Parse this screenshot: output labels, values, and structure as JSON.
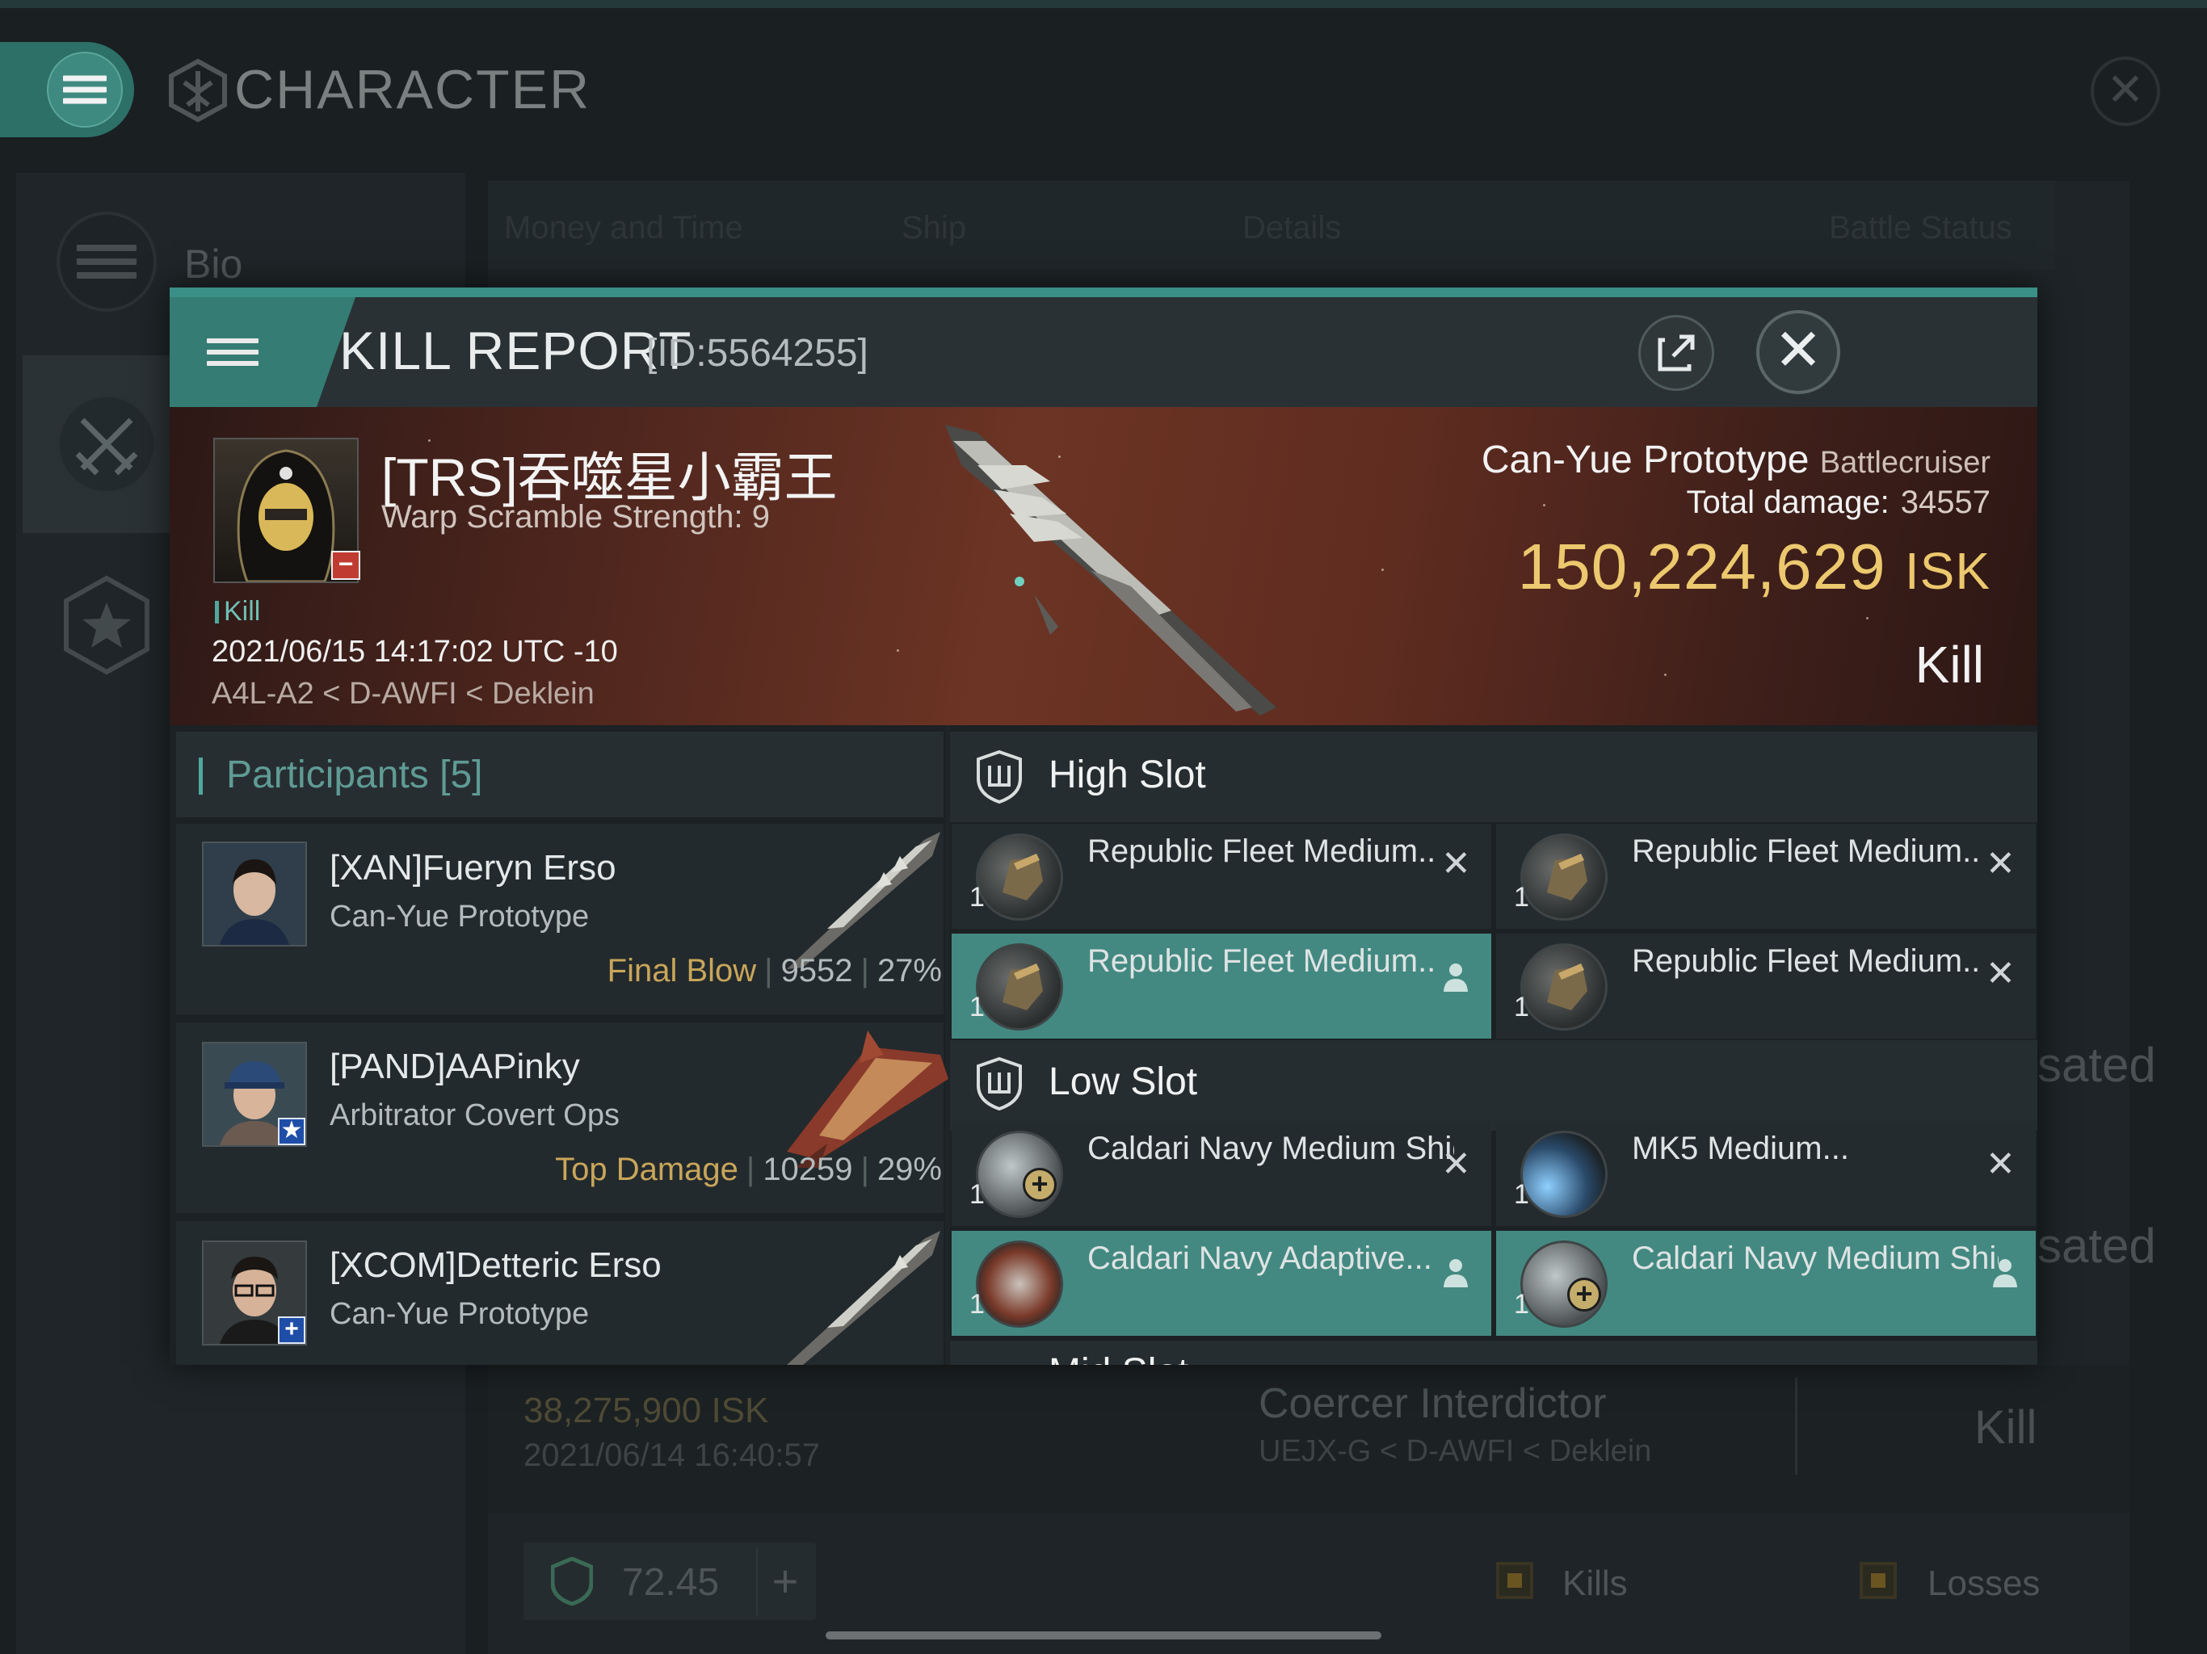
{
  "window": {
    "title": "CHARACTER",
    "close_symbol": "✕"
  },
  "sidebar": {
    "bio_label": "Bio",
    "icons": [
      "list-icon",
      "crossed-swords-icon",
      "star-icon"
    ]
  },
  "background": {
    "tabs": [
      "Money and Time",
      "Ship",
      "Details",
      "Battle Status"
    ],
    "row": {
      "amount": "38,275,900",
      "amount_unit": "ISK",
      "datetime": "2021/06/14  16:40:57",
      "ship": "Coercer Interdictor",
      "system": "UEJX-G < D-AWFI < Deklein",
      "status": "Kill"
    },
    "side_texts": [
      "sated",
      "sated"
    ],
    "bottom": {
      "value": "72.45",
      "plus": "+",
      "kills_label": "Kills",
      "losses_label": "Losses"
    }
  },
  "kill_report": {
    "title": "KILL REPORT",
    "id": "[ID:5564255]",
    "close_symbol": "✕",
    "victim": {
      "name": "[TRS]吞噬星小霸王",
      "warp_scramble": "Warp Scramble Strength: 9",
      "tag": "Kill",
      "datetime": "2021/06/15 14:17:02 UTC -10",
      "location": "A4L-A2 < D-AWFI < Deklein",
      "badge": "−"
    },
    "summary": {
      "ship_name": "Can-Yue Prototype",
      "ship_class": "Battlecruiser",
      "total_damage_label": "Total damage:",
      "total_damage": "34557",
      "isk_value": "150,224,629",
      "isk_unit": "ISK",
      "result": "Kill"
    },
    "participants": {
      "title": "Participants",
      "count": "[5]",
      "items": [
        {
          "name": "[XAN]Fueryn Erso",
          "ship": "Can-Yue Prototype",
          "label": "Final Blow",
          "damage": "9552",
          "percent": "27%"
        },
        {
          "name": "[PAND]AAPinky",
          "ship": "Arbitrator Covert Ops",
          "label": "Top Damage",
          "damage": "10259",
          "percent": "29%",
          "badge": "★"
        },
        {
          "name": "[XCOM]Detteric Erso",
          "ship": "Can-Yue Prototype",
          "label": "",
          "damage": "",
          "percent": "",
          "badge": "+"
        }
      ]
    },
    "slots": {
      "high": {
        "title": "High Slot",
        "modules": [
          {
            "name": "Republic Fleet Medium...",
            "qty": "1",
            "state": "destroyed",
            "icon": "artillery-icon"
          },
          {
            "name": "Republic Fleet Medium...",
            "qty": "1",
            "state": "destroyed",
            "icon": "artillery-icon"
          },
          {
            "name": "Republic Fleet Medium...",
            "qty": "1",
            "state": "dropped",
            "icon": "artillery-icon"
          },
          {
            "name": "Republic Fleet Medium...",
            "qty": "1",
            "state": "destroyed",
            "icon": "artillery-icon"
          }
        ]
      },
      "low": {
        "title": "Low Slot",
        "modules": [
          {
            "name": "Caldari Navy Medium Shield ...",
            "qty": "1",
            "state": "destroyed",
            "icon": "shield-extender-icon"
          },
          {
            "name": "MK5 Medium...",
            "qty": "1",
            "state": "destroyed",
            "icon": "thruster-icon"
          },
          {
            "name": "Caldari Navy Adaptive...",
            "qty": "1",
            "state": "dropped",
            "icon": "adaptive-shield-icon"
          },
          {
            "name": "Caldari Navy Medium Shield ...",
            "qty": "1",
            "state": "dropped",
            "icon": "shield-extender-icon"
          }
        ]
      },
      "mid_partial": {
        "title": "Mid Slot"
      }
    },
    "symbols": {
      "destroyed": "✕",
      "dropped": "👤"
    }
  },
  "colors": {
    "accent": "#438981",
    "isk_gold": "#ecc86e",
    "final_blow": "#c9a65a"
  }
}
